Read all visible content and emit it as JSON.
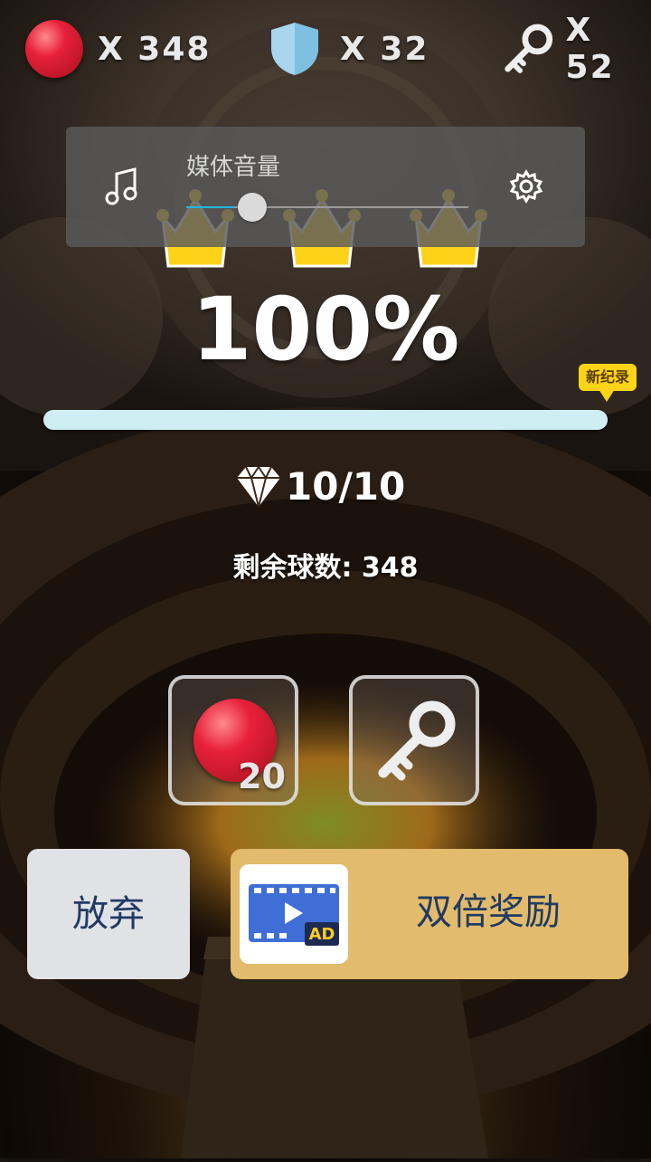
{
  "hud": {
    "balls": {
      "icon": "red-ball-icon",
      "label": "X 348"
    },
    "shields": {
      "icon": "shield-icon",
      "label": "X 32"
    },
    "keys": {
      "icon": "key-icon",
      "label": "X 52"
    }
  },
  "volume": {
    "label": "媒体音量",
    "level": 0.17,
    "left_icon": "music-note-icon",
    "right_icon": "gear-icon"
  },
  "crowns": {
    "count": 3,
    "earned": 3,
    "icon": "crown-icon",
    "color": "#ffd21a"
  },
  "result": {
    "percent": "100%",
    "progress": 1.0,
    "badge": "新纪录"
  },
  "gems": {
    "icon": "diamond-icon",
    "text": "10/10"
  },
  "remaining": {
    "text": "剩余球数: 348"
  },
  "rewards": [
    {
      "icon": "red-ball-icon",
      "count": "20"
    },
    {
      "icon": "key-icon",
      "count": ""
    }
  ],
  "buttons": {
    "give_up": "放弃",
    "double_reward": "双倍奖励",
    "ad_icon": "video-ad-icon",
    "ad_text": "AD"
  },
  "colors": {
    "accent_gold": "#e2bb6c",
    "button_text": "#203a63",
    "crown": "#ffd21a",
    "ball_red": "#e8213a"
  }
}
